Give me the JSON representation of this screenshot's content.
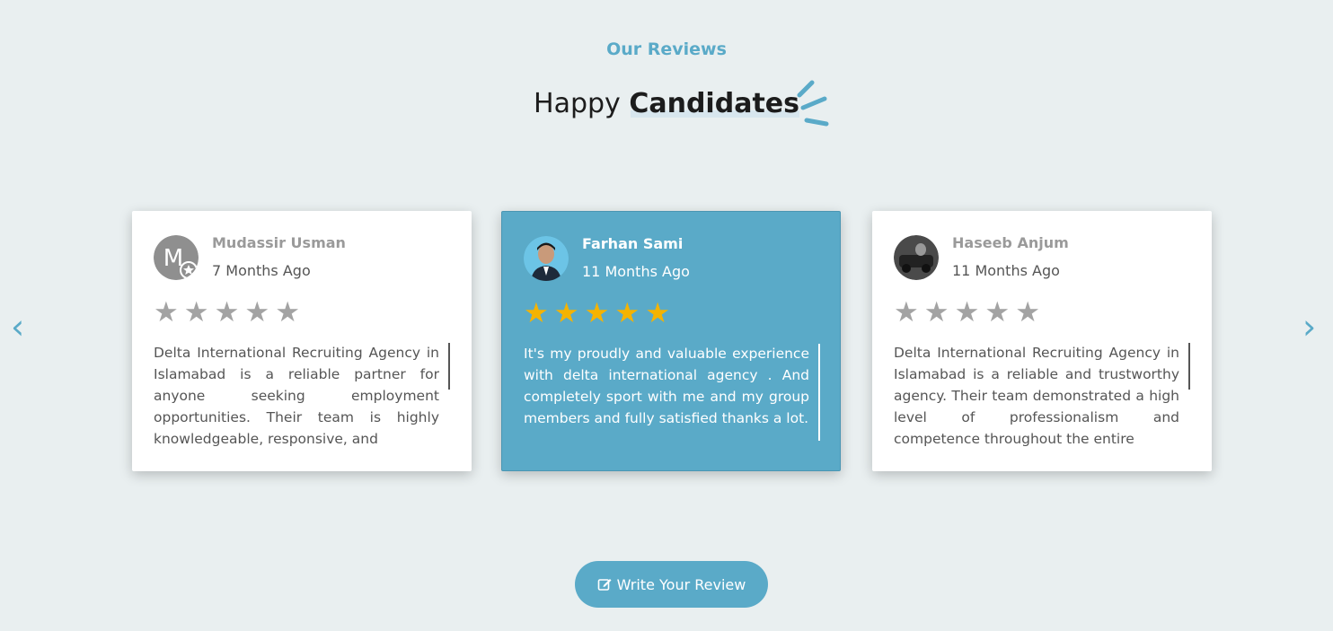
{
  "section": {
    "eyebrow": "Our Reviews",
    "heading_light": "Happy ",
    "heading_bold": "Candidates"
  },
  "reviews": [
    {
      "name": "Mudassir Usman",
      "date": "7 Months Ago",
      "rating": 5,
      "avatar_letter": "M",
      "text": "Delta International Recruiting Agency in Islamabad is a reliable partner for anyone seeking employment opportunities. Their team is highly knowledgeable, responsive, and",
      "active": false
    },
    {
      "name": "Farhan Sami",
      "date": "11 Months Ago",
      "rating": 5,
      "text": "It's my proudly and valuable experience with delta international agency . And completely sport with me and my group members and fully satisfied thanks a lot.",
      "active": true
    },
    {
      "name": "Haseeb Anjum",
      "date": "11 Months Ago",
      "rating": 5,
      "text": "Delta International Recruiting Agency in Islamabad is a reliable and trustworthy agency. Their team demonstrated a high level of professionalism and competence throughout the entire",
      "active": false
    }
  ],
  "nav": {
    "prev": "‹",
    "next": "›"
  },
  "cta": {
    "label": "Write Your Review",
    "icon": "edit-icon"
  },
  "colors": {
    "accent": "#5aaac8",
    "star_active": "#f5b301",
    "star_inactive": "#a3a3a3",
    "background": "#e9eff0"
  }
}
